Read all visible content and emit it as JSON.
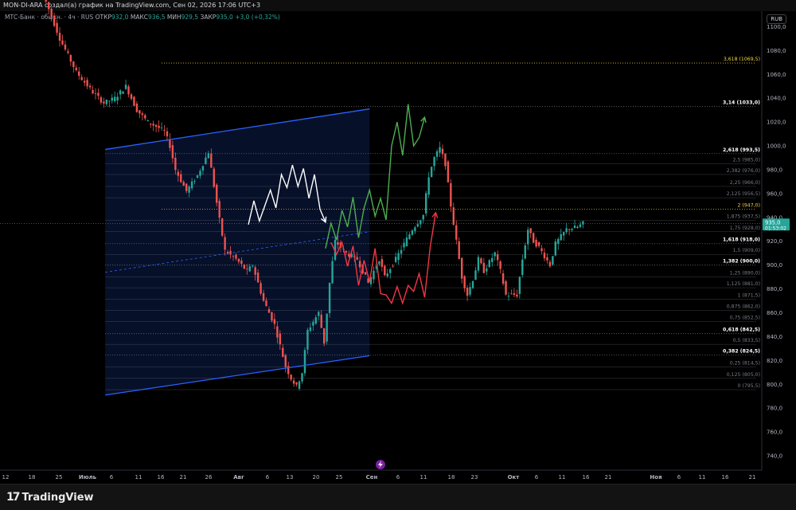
{
  "header": {
    "title": "MON-DI-ARA создал(а) график на TradingView.com, Сен 02, 2026 17:06 UTC+3",
    "symbol": "МТС-Банк · обыкн. · 4ч · RUS",
    "open_label": "ОТКР",
    "open_value": "932,0",
    "high_label": "МАКС",
    "high_value": "936,5",
    "low_label": "МИН",
    "low_value": "929,5",
    "close_label": "ЗАКР",
    "close_value": "935,0",
    "change": "+3,0 (+0,32%)",
    "currency": "RUB"
  },
  "footer": {
    "brand": "TradingView"
  },
  "colors": {
    "up": "#26a69a",
    "down": "#ef5350",
    "channel": "#2962ff",
    "fib": "#787b86",
    "highlight": "#f0d442",
    "green_path": "#4caf50",
    "red_path": "#f23645",
    "white_path": "#ffffff"
  },
  "chart_data": {
    "type": "candlestick",
    "ylim": [
      728,
      1113
    ],
    "y_ticks": [
      "1100,0",
      "1080,0",
      "1060,0",
      "1040,0",
      "1020,0",
      "1000,0",
      "980,0",
      "960,0",
      "940,0",
      "920,0",
      "900,0",
      "880,0",
      "860,0",
      "840,0",
      "820,0",
      "800,0",
      "780,0",
      "760,0",
      "740,0"
    ],
    "y_tick_values": [
      1100,
      1080,
      1060,
      1040,
      1020,
      1000,
      980,
      960,
      940,
      920,
      900,
      880,
      860,
      840,
      820,
      800,
      780,
      760,
      740
    ],
    "x_ticks": [
      "12",
      "18",
      "25",
      "Июль",
      "6",
      "11",
      "16",
      "21",
      "26",
      "Авг",
      "6",
      "13",
      "20",
      "25",
      "Сен",
      "6",
      "11",
      "18",
      "23",
      "Окт",
      "6",
      "11",
      "16",
      "21",
      "Ноя",
      "6",
      "11",
      "16",
      "21"
    ],
    "last_price": "935,0",
    "countdown": "01:53:02",
    "fib_levels": [
      {
        "label": "3,618 (1069,5)",
        "value": 1069.5,
        "highlight": true
      },
      {
        "label": "3,14 (1033,0)",
        "value": 1033.0,
        "bold": true
      },
      {
        "label": "2,618 (993,5)",
        "value": 993.5,
        "bold": true
      },
      {
        "label": "2,5 (985,0)",
        "value": 985.0
      },
      {
        "label": "2,382 (976,0)",
        "value": 976.0
      },
      {
        "label": "2,25 (966,0)",
        "value": 966.0
      },
      {
        "label": "2,125 (956,5)",
        "value": 956.5
      },
      {
        "label": "2 (947,0)",
        "value": 947.0,
        "highlight": true
      },
      {
        "label": "1,875 (937,5)",
        "value": 937.5
      },
      {
        "label": "1,75 (928,0)",
        "value": 928.0
      },
      {
        "label": "1,618 (918,0)",
        "value": 918.0,
        "bold": true
      },
      {
        "label": "1,5 (909,0)",
        "value": 909.0
      },
      {
        "label": "1,382 (900,0)",
        "value": 900.0,
        "bold": true
      },
      {
        "label": "1,25 (890,0)",
        "value": 890.0
      },
      {
        "label": "1,125 (881,0)",
        "value": 881.0
      },
      {
        "label": "1 (871,5)",
        "value": 871.5
      },
      {
        "label": "0,875 (862,0)",
        "value": 862.0
      },
      {
        "label": "0,75 (852,5)",
        "value": 852.5
      },
      {
        "label": "0,618 (842,5)",
        "value": 842.5,
        "bold": true
      },
      {
        "label": "0,5 (833,5)",
        "value": 833.5
      },
      {
        "label": "0,382 (824,5)",
        "value": 824.5,
        "bold": true
      },
      {
        "label": "0,25 (814,5)",
        "value": 814.5
      },
      {
        "label": "0,125 (805,0)",
        "value": 805.0
      },
      {
        "label": "0 (795,5)",
        "value": 795.5
      }
    ],
    "price_path": [
      [
        0,
        1127
      ],
      [
        3,
        1090
      ],
      [
        6,
        1062
      ],
      [
        9,
        1045
      ],
      [
        11,
        1036
      ],
      [
        13,
        1040
      ],
      [
        15,
        1050
      ],
      [
        17,
        1030
      ],
      [
        19,
        1020
      ],
      [
        21,
        1015
      ],
      [
        22,
        1012
      ],
      [
        23,
        1000
      ],
      [
        24,
        980
      ],
      [
        26,
        962
      ],
      [
        28,
        975
      ],
      [
        30,
        995
      ],
      [
        32,
        938
      ],
      [
        33,
        912
      ],
      [
        35,
        905
      ],
      [
        37,
        895
      ],
      [
        38,
        900
      ],
      [
        40,
        870
      ],
      [
        42,
        850
      ],
      [
        44,
        815
      ],
      [
        45,
        805
      ],
      [
        46,
        798
      ],
      [
        47,
        810
      ],
      [
        48,
        845
      ],
      [
        50,
        860
      ],
      [
        51,
        835
      ],
      [
        52,
        885
      ],
      [
        53,
        920
      ],
      [
        55,
        910
      ],
      [
        57,
        905
      ],
      [
        58,
        895
      ],
      [
        59,
        885
      ],
      [
        61,
        905
      ],
      [
        62,
        890
      ],
      [
        64,
        905
      ],
      [
        66,
        922
      ],
      [
        67,
        930
      ],
      [
        69,
        942
      ],
      [
        70,
        975
      ],
      [
        71,
        990
      ],
      [
        72,
        998
      ],
      [
        73,
        985
      ],
      [
        74,
        950
      ],
      [
        76,
        890
      ],
      [
        77,
        875
      ],
      [
        78,
        888
      ],
      [
        79,
        905
      ],
      [
        80,
        895
      ],
      [
        82,
        910
      ],
      [
        83,
        895
      ],
      [
        84,
        875
      ],
      [
        86,
        875
      ],
      [
        87,
        905
      ],
      [
        88,
        930
      ],
      [
        89,
        920
      ],
      [
        90,
        915
      ],
      [
        92,
        900
      ],
      [
        93,
        918
      ],
      [
        95,
        930
      ],
      [
        97,
        932
      ],
      [
        98,
        935
      ]
    ],
    "channel": {
      "upper": [
        [
          11,
          997
        ],
        [
          59,
          1031
        ]
      ],
      "lower": [
        [
          11,
          791
        ],
        [
          59,
          824
        ]
      ],
      "mid": [
        [
          11,
          894
        ],
        [
          59,
          928
        ]
      ]
    },
    "white_path": [
      [
        37,
        934
      ],
      [
        38,
        954
      ],
      [
        39,
        937
      ],
      [
        41,
        963
      ],
      [
        42,
        948
      ],
      [
        43,
        976
      ],
      [
        44,
        965
      ],
      [
        45,
        984
      ],
      [
        46,
        966
      ],
      [
        47,
        981
      ],
      [
        48,
        956
      ],
      [
        49,
        976
      ],
      [
        50,
        947
      ],
      [
        51,
        936
      ]
    ],
    "green_path": [
      [
        51,
        914
      ],
      [
        52,
        935
      ],
      [
        53,
        921
      ],
      [
        54,
        946
      ],
      [
        55,
        932
      ],
      [
        56,
        957
      ],
      [
        57,
        923
      ],
      [
        58,
        948
      ],
      [
        59,
        963
      ],
      [
        60,
        941
      ],
      [
        61,
        956
      ],
      [
        62,
        938
      ],
      [
        63,
        1000
      ],
      [
        64,
        1020
      ],
      [
        65,
        992
      ],
      [
        66,
        1035
      ],
      [
        67,
        1000
      ],
      [
        68,
        1007
      ],
      [
        69,
        1024
      ]
    ],
    "red_path": [
      [
        52,
        919
      ],
      [
        53,
        909
      ],
      [
        54,
        919
      ],
      [
        55,
        899
      ],
      [
        56,
        916
      ],
      [
        57,
        883
      ],
      [
        58,
        904
      ],
      [
        59,
        886
      ],
      [
        60,
        914
      ],
      [
        61,
        876
      ],
      [
        62,
        875
      ],
      [
        63,
        868
      ],
      [
        64,
        882
      ],
      [
        65,
        868
      ],
      [
        66,
        883
      ],
      [
        67,
        878
      ],
      [
        68,
        893
      ],
      [
        69,
        873
      ],
      [
        70,
        915
      ],
      [
        71,
        944
      ]
    ]
  }
}
